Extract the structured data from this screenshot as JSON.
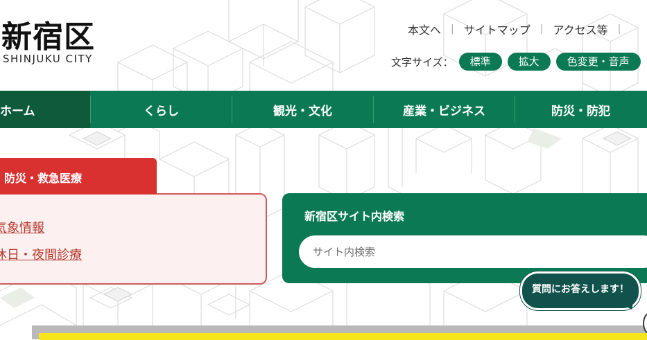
{
  "logo": {
    "kanji": "新宿区",
    "en": "SHINJUKU CITY"
  },
  "utility_links": [
    {
      "label": "本文へ"
    },
    {
      "label": "サイトマップ"
    },
    {
      "label": "アクセス等"
    }
  ],
  "font_size": {
    "label": "文字サイズ：",
    "buttons": [
      {
        "label": "標準"
      },
      {
        "label": "拡大"
      },
      {
        "label": "色変更・音声"
      }
    ]
  },
  "nav": [
    {
      "label": "ホーム"
    },
    {
      "label": "くらし"
    },
    {
      "label": "観光・文化"
    },
    {
      "label": "産業・ビジネス"
    },
    {
      "label": "防災・防犯"
    }
  ],
  "alert": {
    "tab_label": "防災・救急医療",
    "links": [
      {
        "label": "気象情報"
      },
      {
        "label": "休日・夜間診療"
      }
    ]
  },
  "search": {
    "title": "新宿区サイト内検索",
    "placeholder": "サイト内検索"
  },
  "chat_bubble": {
    "label": "質問にお答えします！"
  },
  "colors": {
    "brand_green": "#0b7a54",
    "nav_active": "#0e5a3b",
    "alert_red": "#d93030",
    "alert_bg": "#fdf0f0",
    "chat_teal": "#11524d",
    "accent_yellow": "#f5e51a"
  }
}
